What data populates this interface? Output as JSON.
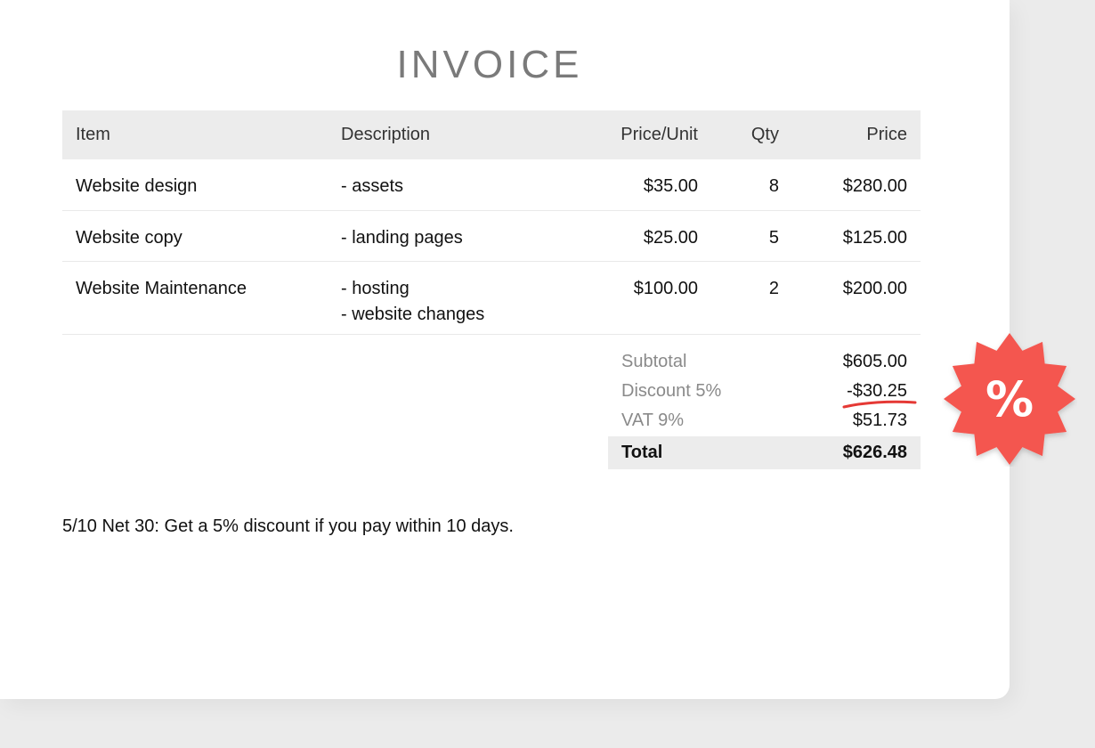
{
  "invoice": {
    "title": "INVOICE",
    "headers": {
      "item": "Item",
      "description": "Description",
      "price_unit": "Price/Unit",
      "qty": "Qty",
      "price": "Price"
    },
    "rows": [
      {
        "item": "Website design",
        "desc": [
          "- assets"
        ],
        "price_unit": "$35.00",
        "qty": "8",
        "price": "$280.00"
      },
      {
        "item": "Website copy",
        "desc": [
          "- landing pages"
        ],
        "price_unit": "$25.00",
        "qty": "5",
        "price": "$125.00"
      },
      {
        "item": "Website Maintenance",
        "desc": [
          "- hosting",
          "- website changes"
        ],
        "price_unit": "$100.00",
        "qty": "2",
        "price": "$200.00"
      }
    ],
    "totals": {
      "subtotal_label": "Subtotal",
      "subtotal_value": "$605.00",
      "discount_label": "Discount 5%",
      "discount_value": "-$30.25",
      "vat_label": "VAT 9%",
      "vat_value": "$51.73",
      "total_label": "Total",
      "total_value": "$626.48"
    },
    "note": "5/10 Net 30: Get a 5% discount if you pay within 10 days."
  },
  "badge": {
    "symbol": "%",
    "color": "#f4564f"
  },
  "colors": {
    "accent_underline": "#e53935",
    "header_bg": "#ececec"
  }
}
